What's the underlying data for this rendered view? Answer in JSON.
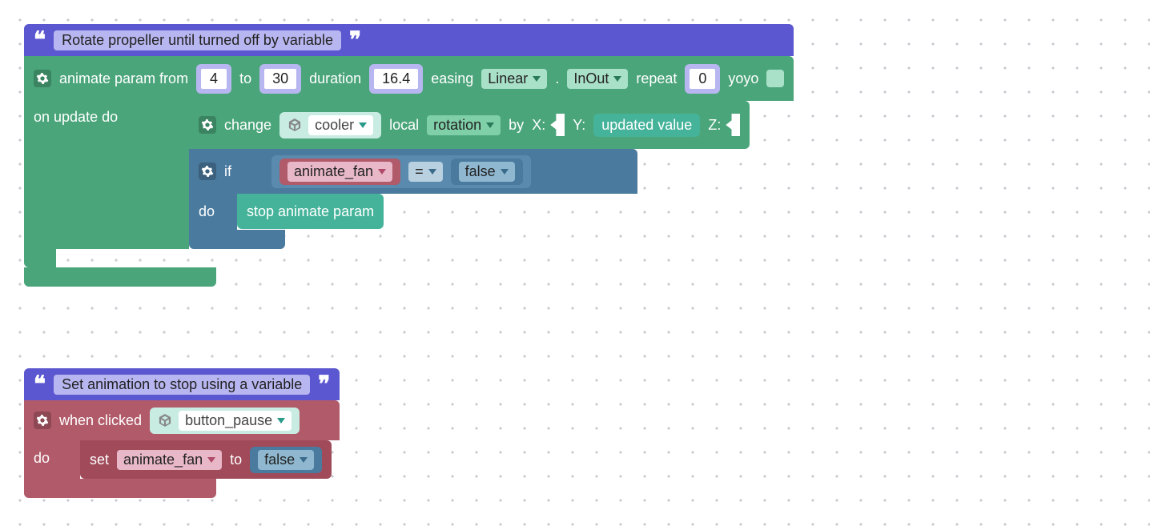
{
  "workspace": {
    "block1": {
      "comment": "Rotate propeller until turned off by variable",
      "animate": {
        "label_animate": "animate param from",
        "from": "4",
        "label_to": "to",
        "to": "30",
        "label_duration": "duration",
        "duration": "16.4",
        "label_easing": "easing",
        "easing": "Linear",
        "dot": ".",
        "easing_mode": "InOut",
        "label_repeat": "repeat",
        "repeat": "0",
        "label_yoyo": "yoyo",
        "label_on_update": "on update do"
      },
      "change": {
        "label_change": "change",
        "object": "cooler",
        "label_local": "local",
        "property": "rotation",
        "label_by": "by",
        "x_label": "X:",
        "y_label": "Y:",
        "y_value": "updated value",
        "z_label": "Z:"
      },
      "if": {
        "label_if": "if",
        "var": "animate_fan",
        "op": "=",
        "val": "false",
        "label_do": "do",
        "action": "stop animate param"
      }
    },
    "block2": {
      "comment": "Set animation to stop using a variable",
      "event": {
        "label_when": "when clicked",
        "object": "button_pause",
        "label_do": "do"
      },
      "set": {
        "label_set": "set",
        "var": "animate_fan",
        "label_to": "to",
        "val": "false"
      }
    }
  }
}
